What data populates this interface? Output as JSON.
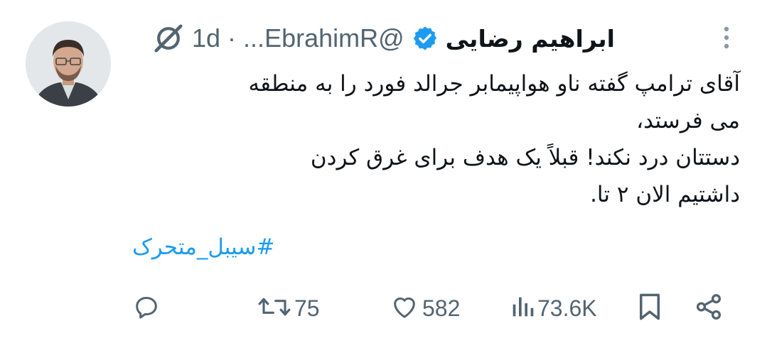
{
  "tweet": {
    "author_name": "ابراهیم رضایی",
    "handle": "@EbrahimR...",
    "separator": "·",
    "time": "1d",
    "text_lines": [
      "آقای ترامپ گفته ناو هواپیمابر جرالد فورد را به منطقه",
      "می فرستد،",
      "دستتان درد نکند! قبلاً یک هدف برای غرق کردن",
      "داشتیم الان ۲ تا."
    ],
    "hashtag": "#سیبل_متحرک"
  },
  "actions": {
    "reply_count": "",
    "retweet_count": "75",
    "like_count": "582",
    "views_count": "73.6K"
  },
  "icons": {
    "verified": "verified-badge-icon",
    "grok": "grok-icon",
    "more": "more-vertical-icon",
    "reply": "reply-icon",
    "retweet": "retweet-icon",
    "like": "heart-icon",
    "views": "views-icon",
    "bookmark": "bookmark-icon",
    "share": "share-icon"
  },
  "colors": {
    "text": "#0f1419",
    "secondary": "#536471",
    "link": "#1d9bf0",
    "verified": "#1d9bf0"
  }
}
